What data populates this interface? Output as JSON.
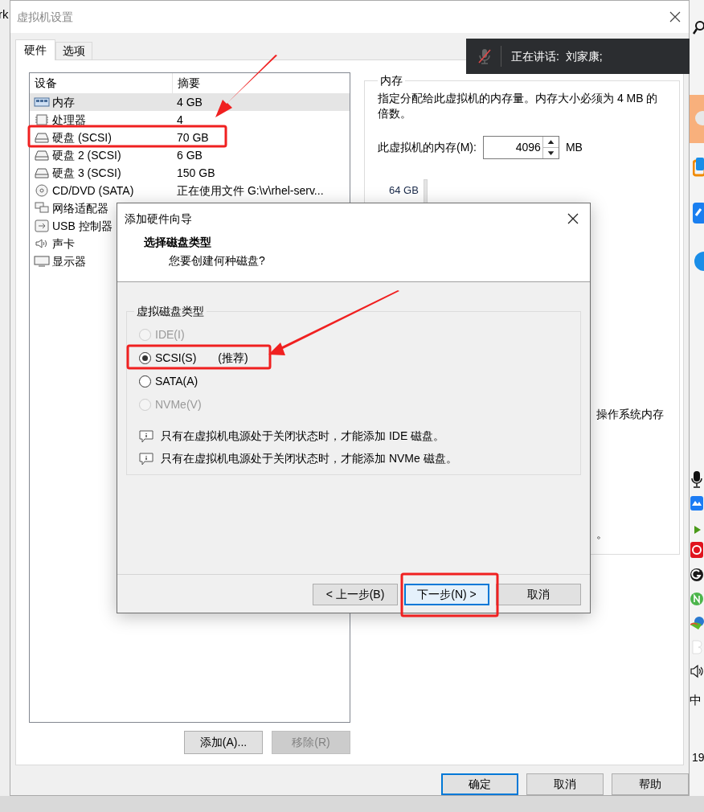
{
  "background_window": {
    "title_fragment": "rk"
  },
  "window": {
    "title": "虚拟机设置"
  },
  "tabs": [
    {
      "label": "硬件",
      "selected": true
    },
    {
      "label": "选项",
      "selected": false
    }
  ],
  "device_table": {
    "columns": [
      "设备",
      "摘要"
    ],
    "rows": [
      {
        "kind": "memory",
        "device": "内存",
        "summary": "4 GB",
        "selected": true
      },
      {
        "kind": "cpu",
        "device": "处理器",
        "summary": "4",
        "selected": false
      },
      {
        "kind": "disk",
        "device": "硬盘 (SCSI)",
        "summary": "70 GB",
        "selected": false
      },
      {
        "kind": "disk",
        "device": "硬盘 2 (SCSI)",
        "summary": "6 GB",
        "selected": false
      },
      {
        "kind": "disk",
        "device": "硬盘 3 (SCSI)",
        "summary": "150 GB",
        "selected": false
      },
      {
        "kind": "cd",
        "device": "CD/DVD (SATA)",
        "summary": "正在使用文件 G:\\v\\rhel-serv...",
        "selected": false
      },
      {
        "kind": "network",
        "device": "网络适配器",
        "selected": false
      },
      {
        "kind": "usb",
        "device": "USB 控制器",
        "selected": false
      },
      {
        "kind": "sound",
        "device": "声卡",
        "selected": false
      },
      {
        "kind": "display",
        "device": "显示器",
        "selected": false
      }
    ]
  },
  "device_buttons": [
    {
      "label": "添加(A)...",
      "disabled": false
    },
    {
      "label": "移除(R)",
      "disabled": true
    }
  ],
  "memory_panel": {
    "title": "内存",
    "description": "指定分配给此虚拟机的内存量。内存大小必须为 4 MB 的倍数。",
    "field_label": "此虚拟机的内存(M):",
    "value": "4096",
    "unit": "MB",
    "scale_label": "64 GB",
    "hint_fragment": "操作系统内存",
    "hint_end": "。"
  },
  "footer_buttons": [
    {
      "label": "确定",
      "default": true
    },
    {
      "label": "取消",
      "default": false
    },
    {
      "label": "帮助",
      "default": false
    }
  ],
  "meeting_bar": {
    "text": "正在讲话:  刘家康;",
    "mic_muted": true
  },
  "wizard": {
    "title": "添加硬件向导",
    "heading": "选择磁盘类型",
    "subheading": "您要创建何种磁盘?",
    "group_title": "虚拟磁盘类型",
    "options": [
      {
        "label": "IDE(I)",
        "selected": false,
        "disabled": true
      },
      {
        "label": "SCSI(S)",
        "note": "(推荐)",
        "selected": true,
        "disabled": false
      },
      {
        "label": "SATA(A)",
        "selected": false,
        "disabled": false
      },
      {
        "label": "NVMe(V)",
        "selected": false,
        "disabled": true
      }
    ],
    "notes": [
      "只有在虚拟机电源处于关闭状态时，才能添加 IDE 磁盘。",
      "只有在虚拟机电源处于关闭状态时，才能添加 NVMe 磁盘。"
    ],
    "buttons": [
      {
        "label": "< 上一步(B)",
        "focused": false
      },
      {
        "label": "下一步(N) >",
        "focused": true
      },
      {
        "label": "取消",
        "focused": false
      }
    ]
  },
  "tray": {
    "ime": "中",
    "clock_fragment": "19"
  }
}
